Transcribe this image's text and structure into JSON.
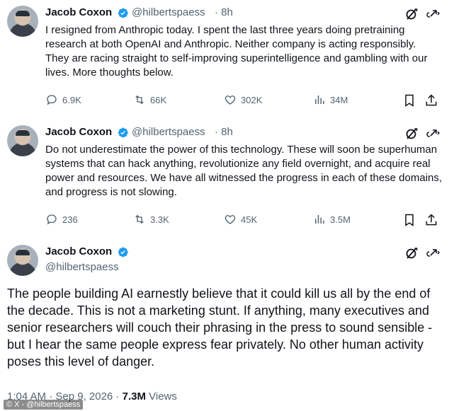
{
  "tweets": [
    {
      "author": "Jacob Coxon",
      "handle": "@hilbertspaess",
      "time": "· 8h",
      "text": "I resigned from Anthropic today. I spent the last three years doing pretraining research at both OpenAI and Anthropic. Neither company is acting responsibly. They are racing straight to self-improving superintelligence and gambling with our lives. More thoughts below.",
      "replies": "6.9K",
      "reposts": "66K",
      "likes": "302K",
      "views": "34M"
    },
    {
      "author": "Jacob Coxon",
      "handle": "@hilbertspaess",
      "time": "· 8h",
      "text": "Do not underestimate the power of this technology. These will soon be superhuman systems that can hack anything, revolutionize any field overnight, and acquire real power and resources. We have all witnessed the progress in each of these domains, and progress is not slowing.",
      "replies": "236",
      "reposts": "3.3K",
      "likes": "45K",
      "views": "3.5M"
    }
  ],
  "main_tweet": {
    "author": "Jacob Coxon",
    "handle": "@hilbertspaess",
    "text": "The people building AI earnestly believe that it could kill us all by the end of the decade. This is not a marketing stunt. If anything, many executives and senior researchers will couch their phrasing in the press to sound sensible - but I hear the same people express fear privately. No other human activity poses this level of danger.",
    "timestamp": "1:04 AM · Sep 9, 2026 ·",
    "views_count": "7.3M",
    "views_label": "Views"
  },
  "watermark": "© X - @hilbertspaess",
  "colors": {
    "verified": "#1d9bf0",
    "secondary_text": "#536471",
    "primary_text": "#0f1419"
  },
  "icons": [
    "verified-badge-icon",
    "grok-icon",
    "more-icon",
    "reply-icon",
    "repost-icon",
    "like-icon",
    "views-icon",
    "bookmark-icon",
    "share-icon"
  ]
}
